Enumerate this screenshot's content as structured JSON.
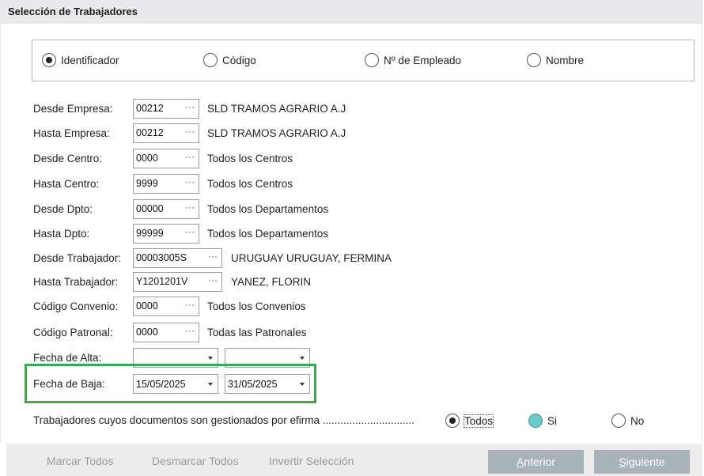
{
  "window": {
    "title": "Selección de Trabajadores"
  },
  "sort_options": [
    {
      "label": "Identificador",
      "checked": true
    },
    {
      "label": "Código",
      "checked": false
    },
    {
      "label": "Nº de Empleado",
      "checked": false
    },
    {
      "label": "Nombre",
      "checked": false
    }
  ],
  "fields": {
    "desde_empresa": {
      "label": "Desde Empresa:",
      "value": "00212",
      "desc": "SLD TRAMOS AGRARIO A.J"
    },
    "hasta_empresa": {
      "label": "Hasta Empresa:",
      "value": "00212",
      "desc": "SLD TRAMOS AGRARIO A.J"
    },
    "desde_centro": {
      "label": "Desde Centro:",
      "value": "0000",
      "desc": "Todos los Centros"
    },
    "hasta_centro": {
      "label": "Hasta Centro:",
      "value": "9999",
      "desc": "Todos los Centros"
    },
    "desde_dpto": {
      "label": "Desde Dpto:",
      "value": "00000",
      "desc": "Todos los Departamentos"
    },
    "hasta_dpto": {
      "label": "Hasta Dpto:",
      "value": "99999",
      "desc": "Todos los Departamentos"
    },
    "desde_trabajador": {
      "label": "Desde Trabajador:",
      "value": "00003005S",
      "desc": "URUGUAY URUGUAY, FERMINA"
    },
    "hasta_trabajador": {
      "label": "Hasta Trabajador:",
      "value": "Y1201201V",
      "desc": "YANEZ, FLORIN"
    },
    "codigo_convenio": {
      "label": "Código Convenio:",
      "value": "0000",
      "desc": "Todos los Convenios"
    },
    "codigo_patronal": {
      "label": "Código Patronal:",
      "value": "0000",
      "desc": "Todas las Patronales"
    }
  },
  "lookup_glyph": "···",
  "fecha_alta": {
    "label": "Fecha de Alta:",
    "desde": "",
    "hasta": ""
  },
  "fecha_baja": {
    "label": "Fecha de Baja:",
    "desde": "15/05/2025",
    "hasta": "31/05/2025"
  },
  "efirma": {
    "label": "Trabajadores cuyos documentos son gestionados por efirma ...............................",
    "options": [
      {
        "label": "Todos",
        "checked": true
      },
      {
        "label": "Si",
        "checked": false
      },
      {
        "label": "No",
        "checked": false
      }
    ]
  },
  "footer": {
    "marcar": "Marcar Todos",
    "desmarcar": "Desmarcar Todos",
    "invertir": "Invertir Selección",
    "anterior_first": "A",
    "anterior_rest": "nterior",
    "siguiente_first": "S",
    "siguiente_rest": "iguiente"
  },
  "colors": {
    "highlight": "#3aa94b",
    "nav_button": "#a7b2b9",
    "radio_accent": "#6cc9c9"
  }
}
